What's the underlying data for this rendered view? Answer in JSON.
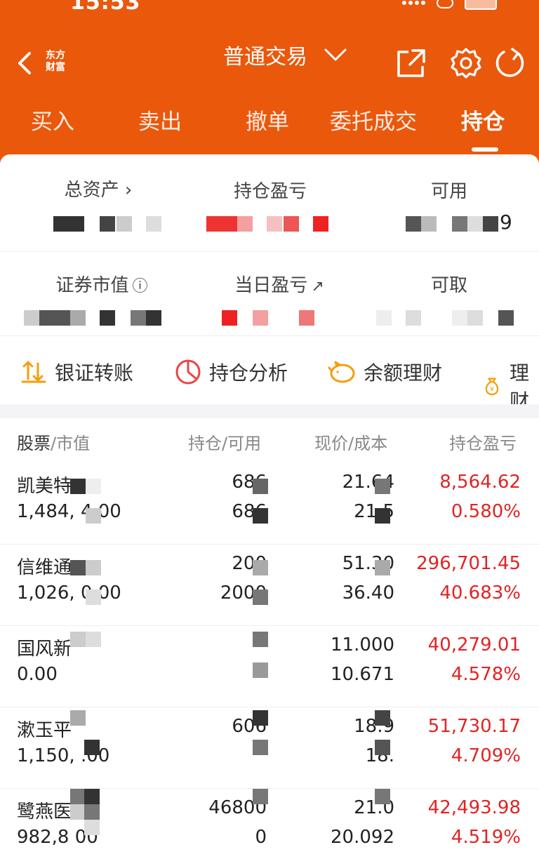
{
  "status": {
    "time": "15:53",
    "battery": "27"
  },
  "nav": {
    "logo_line1": "东方",
    "logo_line2": "财富",
    "title": "普通交易"
  },
  "tabs": [
    "买入",
    "卖出",
    "撤单",
    "委托成交",
    "持仓"
  ],
  "summary": {
    "total_assets": "总资产",
    "position_pl": "持仓盈亏",
    "available": "可用",
    "securities_value": "证券市值",
    "daily_pl": "当日盈亏",
    "withdrawable": "可取",
    "total_assets_partial": "9"
  },
  "quick_actions": [
    "银证转账",
    "持仓分析",
    "余额理财",
    "理财"
  ],
  "list_header": {
    "col1a": "股票",
    "col1b": "市值",
    "col2a": "持仓",
    "col2b": "可用",
    "col3a": "现价",
    "col3b": "成本",
    "col4": "持仓盈亏"
  },
  "holdings": [
    {
      "name": "凯美特",
      "market_value": "1,484,    4.00",
      "hold": "686",
      "avail": "686",
      "price": "21.64",
      "cost": "21.5",
      "pl": "8,564.62",
      "pl_pct": "0.580%"
    },
    {
      "name": "信维通",
      "market_value": "1,026,    0.00",
      "hold": "200",
      "avail": "2000",
      "price": "51.30",
      "cost": "36.40",
      "pl": "296,701.45",
      "pl_pct": "40.683%"
    },
    {
      "name": "国风新",
      "market_value": "0.00",
      "hold": "",
      "avail": "",
      "price": "11.000",
      "cost": "10.671",
      "pl": "40,279.01",
      "pl_pct": "4.578%"
    },
    {
      "name": "漱玉平",
      "market_value": "1,150,    .00",
      "hold": "606",
      "avail": "",
      "price": "18.9",
      "cost": "18.",
      "pl": "51,730.17",
      "pl_pct": "4.709%"
    },
    {
      "name": "鹭燕医",
      "market_value": "982,8    00",
      "hold": "46800",
      "avail": "0",
      "price": "21.0",
      "cost": "20.092",
      "pl": "42,493.98",
      "pl_pct": "4.519%"
    }
  ],
  "colors": {
    "brand": "#ea580c",
    "gain": "#e02424"
  },
  "icons": [
    "back-icon",
    "share-icon",
    "settings-icon",
    "refresh-icon",
    "chevron-down-icon",
    "transfer-icon",
    "pie-chart-icon",
    "piggy-bank-icon",
    "money-bag-icon",
    "info-icon",
    "external-link-icon"
  ]
}
